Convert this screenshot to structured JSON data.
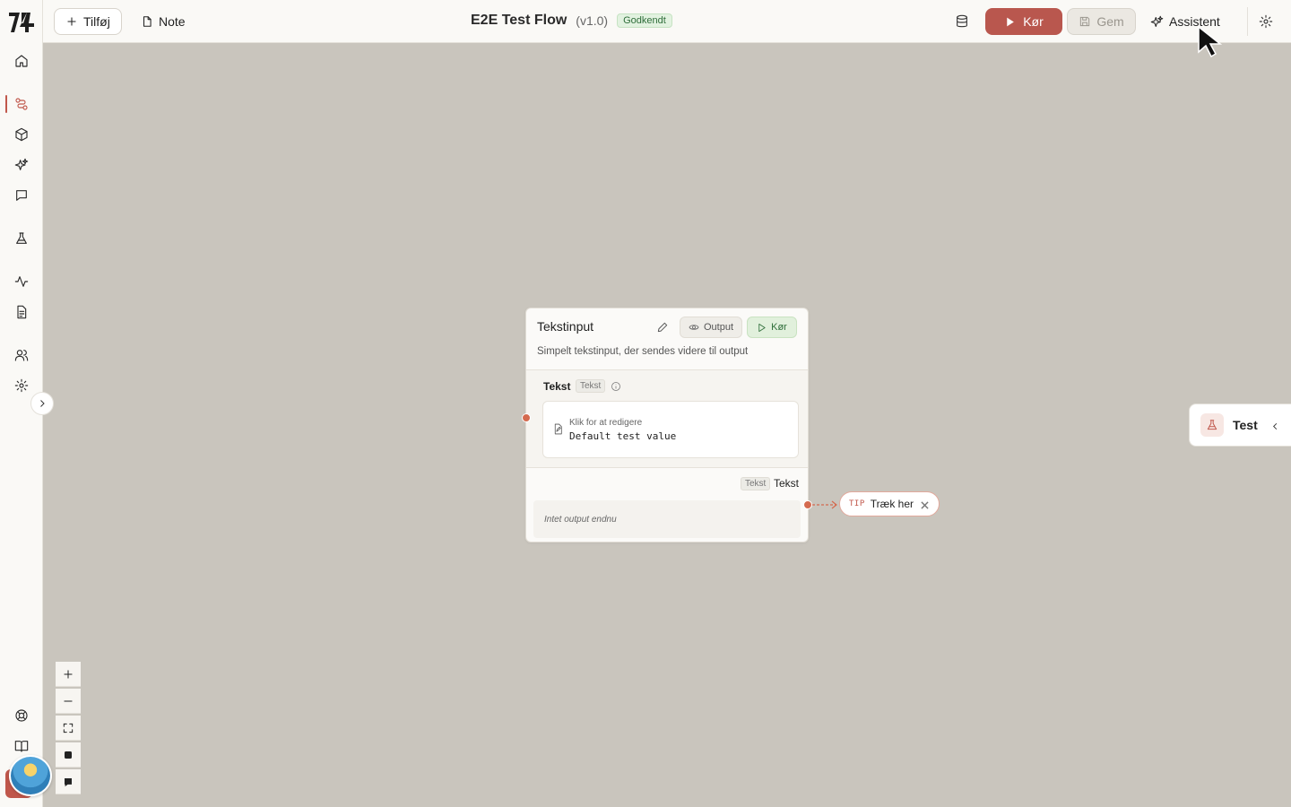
{
  "topbar": {
    "add_label": "Tilføj",
    "note_label": "Note",
    "flow_title": "E2E Test Flow",
    "flow_version": "(v1.0)",
    "status_badge": "Godkendt",
    "run_label": "Kør",
    "save_label": "Gem",
    "assistant_label": "Assistent"
  },
  "sidebar": {
    "items": [
      {
        "icon": "home-icon"
      },
      {
        "icon": "flows-icon",
        "active": true
      },
      {
        "icon": "package-icon"
      },
      {
        "icon": "sparkles-icon"
      },
      {
        "icon": "chat-icon"
      },
      {
        "icon": "flask-icon"
      },
      {
        "icon": "activity-icon"
      },
      {
        "icon": "document-icon"
      },
      {
        "icon": "users-icon"
      },
      {
        "icon": "gear-icon"
      },
      {
        "icon": "help-icon"
      },
      {
        "icon": "book-icon"
      }
    ]
  },
  "node": {
    "title": "Tekstinput",
    "output_label": "Output",
    "run_label": "Kør",
    "description": "Simpelt tekstinput, der sendes videre til output",
    "input": {
      "label": "Tekst",
      "type": "Tekst",
      "edit_hint": "Klik for at redigere",
      "value": "Default test value"
    },
    "output": {
      "label": "Tekst",
      "type": "Tekst",
      "empty_text": "Intet output endnu"
    }
  },
  "tip": {
    "tag": "TIP",
    "text": "Træk her"
  },
  "test_panel": {
    "label": "Test"
  },
  "colors": {
    "accent": "#c0574b",
    "run_button": "#b9574e",
    "approved_badge_bg": "#e2f2e0",
    "canvas_bg": "#f3f1ec"
  }
}
